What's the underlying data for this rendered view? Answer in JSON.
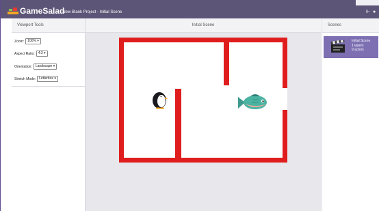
{
  "app": {
    "logo_text": "GameSalad",
    "breadcrumb": "/ New Blank Project - Initial Scene",
    "window_controls": "⊩ ●"
  },
  "viewport_tools": {
    "title": "Viewport Tools",
    "zoom_label": "Zoom:",
    "zoom_value": "100%",
    "aspect_label": "Aspect Ratio:",
    "aspect_value": "4:3",
    "orientation_label": "Orientation:",
    "orientation_value": "Landscape",
    "stretch_label": "Stretch Mode:",
    "stretch_value": "Letterbox"
  },
  "scene": {
    "title": "Initial Scene",
    "actors": [
      "penguin",
      "fish"
    ],
    "wall_color": "#e01d1d"
  },
  "scenes_panel": {
    "title": "Scenes",
    "items": [
      {
        "name": "Initial Scene",
        "layers": "1 layers",
        "actors": "9 actors"
      }
    ]
  },
  "colors": {
    "titlebar": "#5d5577",
    "scene_card": "#7d6fb2"
  }
}
